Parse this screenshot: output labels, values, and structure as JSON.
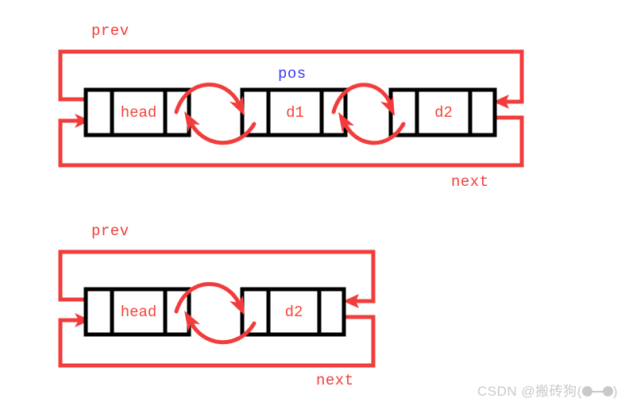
{
  "image": {
    "title": "Doubly linked list erase illustration",
    "background_color": "#ffffff",
    "accent_red": "#f23c3c",
    "accent_blue": "#3a3af0",
    "node_border_color": "#000000",
    "watermark": {
      "prefix": "CSDN @",
      "author": "搬砖狗",
      "emoticon_open": "(",
      "emoticon_close": ")"
    }
  },
  "diagrams": [
    {
      "id": "before",
      "labels": {
        "prev": "prev",
        "pos": "pos",
        "next": "next"
      },
      "nodes": [
        {
          "id": "head",
          "label": "head"
        },
        {
          "id": "d1",
          "label": "d1"
        },
        {
          "id": "d2",
          "label": "d2"
        }
      ]
    },
    {
      "id": "after",
      "labels": {
        "prev": "prev",
        "next": "next"
      },
      "nodes": [
        {
          "id": "head",
          "label": "head"
        },
        {
          "id": "d2",
          "label": "d2"
        }
      ]
    }
  ]
}
